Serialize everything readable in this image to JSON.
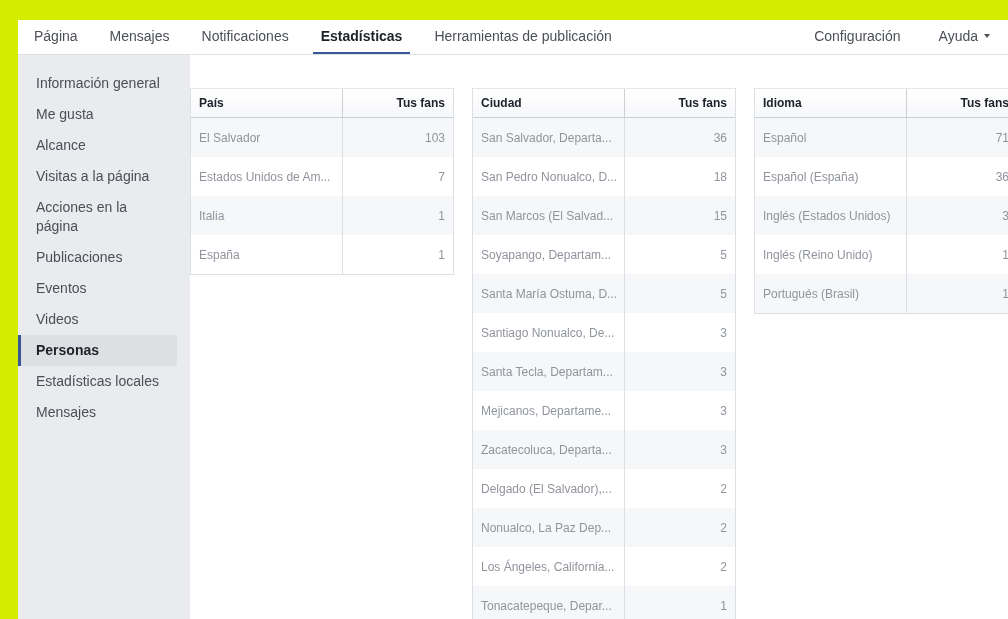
{
  "nav": {
    "tabs": [
      {
        "label": "Página",
        "selected": false
      },
      {
        "label": "Mensajes",
        "selected": false
      },
      {
        "label": "Notificaciones",
        "selected": false
      },
      {
        "label": "Estadísticas",
        "selected": true
      },
      {
        "label": "Herramientas de publicación",
        "selected": false
      }
    ],
    "right_tabs": [
      {
        "label": "Configuración",
        "dropdown": false
      },
      {
        "label": "Ayuda",
        "dropdown": true
      }
    ]
  },
  "sidebar": {
    "items": [
      {
        "label": "Información general",
        "selected": false
      },
      {
        "label": "Me gusta",
        "selected": false
      },
      {
        "label": "Alcance",
        "selected": false
      },
      {
        "label": "Visitas a la página",
        "selected": false
      },
      {
        "label": "Acciones en la página",
        "selected": false
      },
      {
        "label": "Publicaciones",
        "selected": false
      },
      {
        "label": "Eventos",
        "selected": false
      },
      {
        "label": "Videos",
        "selected": false
      },
      {
        "label": "Personas",
        "selected": true
      },
      {
        "label": "Estadísticas locales",
        "selected": false
      },
      {
        "label": "Mensajes",
        "selected": false
      }
    ]
  },
  "tables": [
    {
      "columns": [
        "País",
        "Tus fans"
      ],
      "rows": [
        [
          "El Salvador",
          "103"
        ],
        [
          "Estados Unidos de Am...",
          "7"
        ],
        [
          "Italia",
          "1"
        ],
        [
          "España",
          "1"
        ]
      ]
    },
    {
      "columns": [
        "Ciudad",
        "Tus fans"
      ],
      "rows": [
        [
          "San Salvador, Departa...",
          "36"
        ],
        [
          "San Pedro Nonualco, D...",
          "18"
        ],
        [
          "San Marcos (El Salvad...",
          "15"
        ],
        [
          "Soyapango, Departam...",
          "5"
        ],
        [
          "Santa María Ostuma, D...",
          "5"
        ],
        [
          "Santiago Nonualco, De...",
          "3"
        ],
        [
          "Santa Tecla, Departam...",
          "3"
        ],
        [
          "Mejicanos, Departame...",
          "3"
        ],
        [
          "Zacatecoluca, Departa...",
          "3"
        ],
        [
          "Delgado (El Salvador),...",
          "2"
        ],
        [
          "Nonualco, La Paz Dep...",
          "2"
        ],
        [
          "Los Ángeles, California...",
          "2"
        ],
        [
          "Tonacatepeque, Depar...",
          "1"
        ]
      ]
    },
    {
      "columns": [
        "Idioma",
        "Tus fans"
      ],
      "rows": [
        [
          "Español",
          "71"
        ],
        [
          "Español (España)",
          "36"
        ],
        [
          "Inglés (Estados Unidos)",
          "3"
        ],
        [
          "Inglés (Reino Unido)",
          "1"
        ],
        [
          "Portugués (Brasil)",
          "1"
        ]
      ]
    }
  ]
}
